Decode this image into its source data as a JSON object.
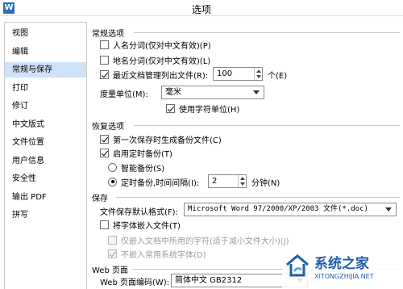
{
  "window": {
    "title": "选项",
    "app_icon": "W"
  },
  "sidebar": {
    "items": [
      {
        "label": "视图"
      },
      {
        "label": "编辑"
      },
      {
        "label": "常规与保存"
      },
      {
        "label": "打印"
      },
      {
        "label": "修订"
      },
      {
        "label": "中文版式"
      },
      {
        "label": "文件位置"
      },
      {
        "label": "用户信息"
      },
      {
        "label": "安全性"
      },
      {
        "label": "输出 PDF"
      },
      {
        "label": "拼写"
      }
    ],
    "active_index": 2
  },
  "general": {
    "header": "常规选项",
    "person_name_seg": {
      "label": "人名分词(仅对中文有效)(P)",
      "checked": false
    },
    "place_name_seg": {
      "label": "地名分词(仅对中文有效)(L)",
      "checked": false
    },
    "recent_docs": {
      "label": "最近文档管理列出文件(R):",
      "checked": true,
      "value": "100",
      "unit": "个(E)"
    },
    "measure_unit": {
      "label": "度量单位(M):",
      "value": "毫米"
    },
    "char_unit": {
      "label": "使用字符单位(H)",
      "checked": true
    }
  },
  "recovery": {
    "header": "恢复选项",
    "first_backup": {
      "label": "第一次保存时生成备份文件(C)",
      "checked": true
    },
    "timed_backup": {
      "label": "启用定时备份(T)",
      "checked": true
    },
    "smart_backup": {
      "label": "智能备份(S)",
      "selected": false
    },
    "interval_backup": {
      "label": "定时备份,时间间隔(I):",
      "selected": true,
      "value": "2",
      "unit": "分钟(N)"
    }
  },
  "save": {
    "header": "保存",
    "default_format": {
      "label": "文件保存默认格式(F):",
      "value": "Microsoft Word 97/2000/XP/2003 文件(*.doc)"
    },
    "embed_fonts": {
      "label": "将字体嵌入文件(T)",
      "checked": false
    },
    "embed_used_chars": {
      "label": "仅嵌入文档中所用的字符(适于减小文件大小)(J)",
      "checked": false
    },
    "no_common_fonts": {
      "label": "不嵌入常用系统字体(D)",
      "checked": true
    }
  },
  "web": {
    "header": "Web 页面",
    "encoding": {
      "label": "Web 页面编码(W):",
      "value": "简体中文 GB2312"
    }
  },
  "watermark": {
    "brand": "系统之家",
    "url": "XITONGZHIJIA.NET"
  },
  "colors": {
    "active_sidebar": "#cfe2f7",
    "watermark": "#1f5fa8",
    "app_icon": "#2f6db5"
  }
}
